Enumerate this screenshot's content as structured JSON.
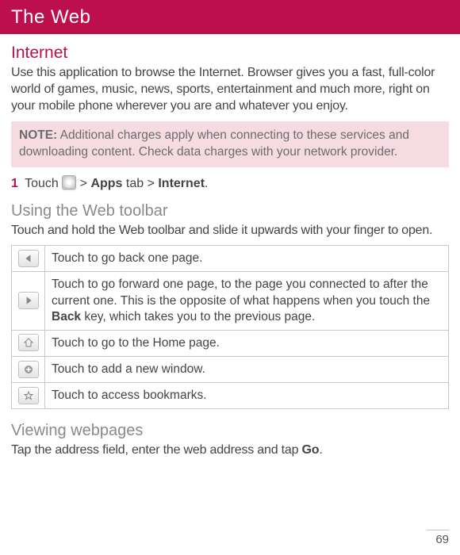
{
  "header": {
    "title": "The Web"
  },
  "internet": {
    "heading": "Internet",
    "intro": "Use this application to browse the Internet. Browser gives you a fast, full-color world of games, music, news, sports, entertainment and much more, right on your mobile phone wherever you are and whatever you enjoy."
  },
  "note": {
    "label": "NOTE:",
    "text": " Additional charges apply when connecting to these services and downloading content. Check data charges with your network provider."
  },
  "step1": {
    "num": "1",
    "p0": "  Touch ",
    "p1": " > ",
    "apps": "Apps",
    "p2": " tab > ",
    "internet": "Internet",
    "p3": "."
  },
  "toolbar": {
    "heading": "Using the Web toolbar",
    "intro": "Touch and hold the Web toolbar and slide it upwards with your finger to open.",
    "rows": [
      {
        "icon": "triangle-left-icon",
        "desc_pre": "Touch to go back one page.",
        "desc_bold": "",
        "desc_post": ""
      },
      {
        "icon": "triangle-right-icon",
        "desc_pre": "Touch to go forward one page, to the page you connected to after the current one. This is the opposite of what happens when you touch the ",
        "desc_bold": "Back",
        "desc_post": " key, which takes you to the previous page."
      },
      {
        "icon": "home-icon",
        "desc_pre": "Touch to go to the Home page.",
        "desc_bold": "",
        "desc_post": ""
      },
      {
        "icon": "plus-circle-icon",
        "desc_pre": "Touch to add a new window.",
        "desc_bold": "",
        "desc_post": ""
      },
      {
        "icon": "star-icon",
        "desc_pre": " Touch to access bookmarks.",
        "desc_bold": "",
        "desc_post": ""
      }
    ]
  },
  "viewing": {
    "heading": "Viewing webpages",
    "text_pre": "Tap the address field, enter the web address and tap ",
    "go": "Go",
    "text_post": "."
  },
  "page_number": "69"
}
